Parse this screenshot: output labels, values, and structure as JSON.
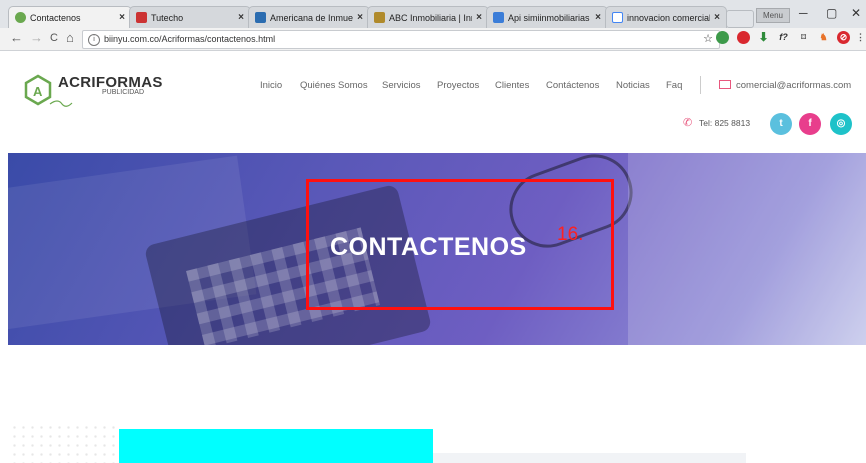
{
  "browser": {
    "tabs": [
      {
        "title": "Contactenos",
        "favicon_color": "#6aa84f",
        "close": "×"
      },
      {
        "title": "Tutecho",
        "favicon_color": "#cc3333",
        "close": "×"
      },
      {
        "title": "Americana de Inmueble",
        "favicon_color": "#2b6cb0",
        "close": "×"
      },
      {
        "title": "ABC Inmobiliaria | Inmu",
        "favicon_color": "#b08a2b",
        "close": "×"
      },
      {
        "title": "Api simiinmobiliarias",
        "favicon_color": "#3b7dd8",
        "close": "×"
      },
      {
        "title": "innovacion comercial -",
        "favicon_color": "#4285f4",
        "close": "×"
      }
    ],
    "user_label": "Menu",
    "window_controls": {
      "minimize": "─",
      "maximize": "▢",
      "close": "✕"
    },
    "nav": {
      "back": "←",
      "forward": "→",
      "reload": "C",
      "home": "⌂"
    },
    "url": "biinyu.com.co/Acriformas/contactenos.html",
    "star": "☆"
  },
  "site": {
    "logo_name": "ACRIFORMAS",
    "logo_sub": "PUBLICIDAD",
    "nav": [
      "Inicio",
      "Quiénes Somos",
      "Servicios",
      "Proyectos",
      "Clientes",
      "Contáctenos",
      "Noticias",
      "Faq"
    ],
    "email": "comercial@acriformas.com",
    "phone": "Tel: 825 8813",
    "social": [
      {
        "name": "twitter",
        "glyph": "t",
        "color": "#5bc0de"
      },
      {
        "name": "facebook",
        "glyph": "f",
        "color": "#e83e8c"
      },
      {
        "name": "instagram",
        "glyph": "◎",
        "color": "#1ec2c9"
      }
    ]
  },
  "hero": {
    "title": "CONTACTENOS"
  },
  "annotation": {
    "label": "16."
  },
  "colors": {
    "accent_green": "#6aa84f",
    "annotation_red": "#ff1010",
    "block_cyan": "#00ffff"
  }
}
